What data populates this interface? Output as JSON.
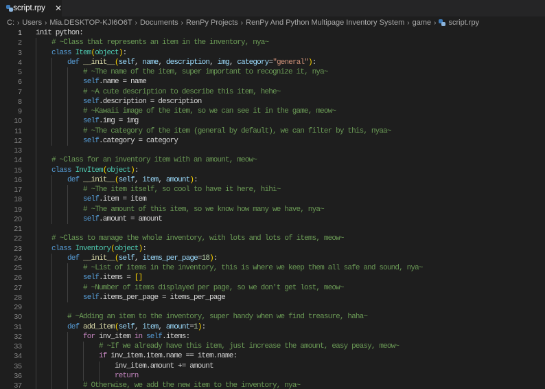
{
  "tab": {
    "label": "script.rpy",
    "icon": "python-file-icon",
    "close": "✕"
  },
  "breadcrumb": [
    "C:",
    "Users",
    "Mia.DESKTOP-KJI6O6T",
    "Documents",
    "RenPy Projects",
    "RenPy And Python Multipage Inventory System",
    "game",
    "script.rpy"
  ],
  "breadcrumb_sep": "›",
  "current_line": 1,
  "colors": {
    "background": "#1e1e1e",
    "keyword": "#569cd6",
    "control": "#c586c0",
    "class": "#4ec9b0",
    "function": "#dcdcaa",
    "comment": "#6a9955",
    "string": "#ce9178"
  },
  "code": [
    {
      "i": 0,
      "t": [
        [
          "t",
          "init python:"
        ]
      ]
    },
    {
      "i": 1,
      "t": [
        [
          "cm",
          "# ~Class that represents an item in the inventory, nya~"
        ]
      ]
    },
    {
      "i": 1,
      "t": [
        [
          "kw",
          "class "
        ],
        [
          "cls",
          "Item"
        ],
        [
          "br",
          "("
        ],
        [
          "cls",
          "object"
        ],
        [
          "br",
          ")"
        ],
        [
          "t",
          ":"
        ]
      ]
    },
    {
      "i": 2,
      "t": [
        [
          "kw",
          "def "
        ],
        [
          "fn",
          "__init__"
        ],
        [
          "br",
          "("
        ],
        [
          "p",
          "self"
        ],
        [
          "t",
          ", "
        ],
        [
          "p",
          "name"
        ],
        [
          "t",
          ", "
        ],
        [
          "p",
          "description"
        ],
        [
          "t",
          ", "
        ],
        [
          "p",
          "img"
        ],
        [
          "t",
          ", "
        ],
        [
          "p",
          "category"
        ],
        [
          "t",
          "="
        ],
        [
          "str",
          "\"general\""
        ],
        [
          "br",
          ")"
        ],
        [
          "t",
          ":"
        ]
      ]
    },
    {
      "i": 3,
      "t": [
        [
          "cm",
          "# ~The name of the item, super important to recognize it, nya~"
        ]
      ]
    },
    {
      "i": 3,
      "t": [
        [
          "kw",
          "self"
        ],
        [
          "t",
          ".name = name"
        ]
      ]
    },
    {
      "i": 3,
      "t": [
        [
          "cm",
          "# ~A cute description to describe this item, hehe~"
        ]
      ]
    },
    {
      "i": 3,
      "t": [
        [
          "kw",
          "self"
        ],
        [
          "t",
          ".description = description"
        ]
      ]
    },
    {
      "i": 3,
      "t": [
        [
          "cm",
          "# ~Kawaii image of the item, so we can see it in the game, meow~"
        ]
      ]
    },
    {
      "i": 3,
      "t": [
        [
          "kw",
          "self"
        ],
        [
          "t",
          ".img = img"
        ]
      ]
    },
    {
      "i": 3,
      "t": [
        [
          "cm",
          "# ~The category of the item (general by default), we can filter by this, nyaa~"
        ]
      ]
    },
    {
      "i": 3,
      "t": [
        [
          "kw",
          "self"
        ],
        [
          "t",
          ".category = category"
        ]
      ]
    },
    {
      "i": 1,
      "t": []
    },
    {
      "i": 1,
      "t": [
        [
          "cm",
          "# ~Class for an inventory item with an amount, meow~"
        ]
      ]
    },
    {
      "i": 1,
      "t": [
        [
          "kw",
          "class "
        ],
        [
          "cls",
          "InvItem"
        ],
        [
          "br",
          "("
        ],
        [
          "cls",
          "object"
        ],
        [
          "br",
          ")"
        ],
        [
          "t",
          ":"
        ]
      ]
    },
    {
      "i": 2,
      "t": [
        [
          "kw",
          "def "
        ],
        [
          "fn",
          "__init__"
        ],
        [
          "br",
          "("
        ],
        [
          "p",
          "self"
        ],
        [
          "t",
          ", "
        ],
        [
          "p",
          "item"
        ],
        [
          "t",
          ", "
        ],
        [
          "p",
          "amount"
        ],
        [
          "br",
          ")"
        ],
        [
          "t",
          ":"
        ]
      ]
    },
    {
      "i": 3,
      "t": [
        [
          "cm",
          "# ~The item itself, so cool to have it here, hihi~"
        ]
      ]
    },
    {
      "i": 3,
      "t": [
        [
          "kw",
          "self"
        ],
        [
          "t",
          ".item = item"
        ]
      ]
    },
    {
      "i": 3,
      "t": [
        [
          "cm",
          "# ~The amount of this item, so we know how many we have, nya~"
        ]
      ]
    },
    {
      "i": 3,
      "t": [
        [
          "kw",
          "self"
        ],
        [
          "t",
          ".amount = amount"
        ]
      ]
    },
    {
      "i": 1,
      "t": []
    },
    {
      "i": 1,
      "t": [
        [
          "cm",
          "# ~Class to manage the whole inventory, with lots and lots of items, meow~"
        ]
      ]
    },
    {
      "i": 1,
      "t": [
        [
          "kw",
          "class "
        ],
        [
          "cls",
          "Inventory"
        ],
        [
          "br",
          "("
        ],
        [
          "cls",
          "object"
        ],
        [
          "br",
          ")"
        ],
        [
          "t",
          ":"
        ]
      ]
    },
    {
      "i": 2,
      "t": [
        [
          "kw",
          "def "
        ],
        [
          "fn",
          "__init__"
        ],
        [
          "br",
          "("
        ],
        [
          "p",
          "self"
        ],
        [
          "t",
          ", "
        ],
        [
          "p",
          "items_per_page"
        ],
        [
          "t",
          "="
        ],
        [
          "num",
          "18"
        ],
        [
          "br",
          ")"
        ],
        [
          "t",
          ":"
        ]
      ]
    },
    {
      "i": 3,
      "t": [
        [
          "cm",
          "# ~List of items in the inventory, this is where we keep them all safe and sound, nya~"
        ]
      ]
    },
    {
      "i": 3,
      "t": [
        [
          "kw",
          "self"
        ],
        [
          "t",
          ".items = "
        ],
        [
          "br",
          "[]"
        ]
      ]
    },
    {
      "i": 3,
      "t": [
        [
          "cm",
          "# ~Number of items displayed per page, so we don't get lost, meow~"
        ]
      ]
    },
    {
      "i": 3,
      "t": [
        [
          "kw",
          "self"
        ],
        [
          "t",
          ".items_per_page = items_per_page"
        ]
      ]
    },
    {
      "i": 2,
      "t": []
    },
    {
      "i": 2,
      "t": [
        [
          "cm",
          "# ~Adding an item to the inventory, super handy when we find treasure, haha~"
        ]
      ]
    },
    {
      "i": 2,
      "t": [
        [
          "kw",
          "def "
        ],
        [
          "fn",
          "add_item"
        ],
        [
          "br",
          "("
        ],
        [
          "p",
          "self"
        ],
        [
          "t",
          ", "
        ],
        [
          "p",
          "item"
        ],
        [
          "t",
          ", "
        ],
        [
          "p",
          "amount"
        ],
        [
          "t",
          "="
        ],
        [
          "num",
          "1"
        ],
        [
          "br",
          ")"
        ],
        [
          "t",
          ":"
        ]
      ]
    },
    {
      "i": 3,
      "t": [
        [
          "ctl",
          "for "
        ],
        [
          "t",
          "inv_item "
        ],
        [
          "ctl",
          "in "
        ],
        [
          "kw",
          "self"
        ],
        [
          "t",
          ".items:"
        ]
      ]
    },
    {
      "i": 4,
      "t": [
        [
          "cm",
          "# ~If we already have this item, just increase the amount, easy peasy, meow~"
        ]
      ]
    },
    {
      "i": 4,
      "t": [
        [
          "ctl",
          "if "
        ],
        [
          "t",
          "inv_item.item.name == item.name:"
        ]
      ]
    },
    {
      "i": 5,
      "t": [
        [
          "t",
          "inv_item.amount += amount"
        ]
      ]
    },
    {
      "i": 5,
      "t": [
        [
          "ctl",
          "return"
        ]
      ]
    },
    {
      "i": 3,
      "t": [
        [
          "cm",
          "# Otherwise, we add the new item to the inventory, nya~"
        ]
      ]
    }
  ]
}
